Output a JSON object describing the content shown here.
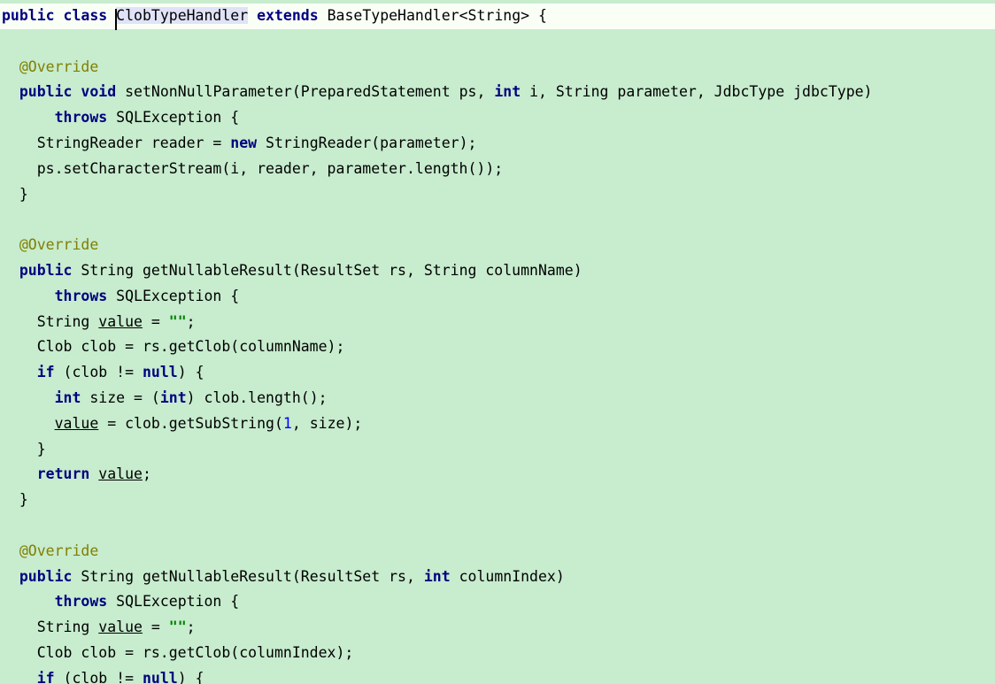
{
  "editor": {
    "language": "java",
    "colors": {
      "background": "#c7ecce",
      "current_line": "#fafff6",
      "keyword": "#000080",
      "annotation": "#808000",
      "string": "#008000",
      "number": "#0000ff",
      "identifier_highlight": "#e0e3f8"
    },
    "lines": [
      {
        "tokens": [
          {
            "t": "public",
            "c": "kw"
          },
          {
            "t": " "
          },
          {
            "t": "class",
            "c": "kw"
          },
          {
            "t": " "
          },
          {
            "t": "ClobTypeHandler",
            "c": "hl",
            "caret": true
          },
          {
            "t": " "
          },
          {
            "t": "extends",
            "c": "kw"
          },
          {
            "t": " BaseTypeHandler<String> {"
          }
        ],
        "current": true
      },
      {
        "tokens": []
      },
      {
        "tokens": [
          {
            "t": "  "
          },
          {
            "t": "@Override",
            "c": "ann"
          }
        ]
      },
      {
        "tokens": [
          {
            "t": "  "
          },
          {
            "t": "public",
            "c": "kw"
          },
          {
            "t": " "
          },
          {
            "t": "void",
            "c": "kw"
          },
          {
            "t": " setNonNullParameter(PreparedStatement ps, "
          },
          {
            "t": "int",
            "c": "kw"
          },
          {
            "t": " i, String parameter, JdbcType jdbcType)"
          }
        ]
      },
      {
        "tokens": [
          {
            "t": "      "
          },
          {
            "t": "throws",
            "c": "kw"
          },
          {
            "t": " SQLException {"
          }
        ]
      },
      {
        "tokens": [
          {
            "t": "    StringReader reader = "
          },
          {
            "t": "new",
            "c": "kw"
          },
          {
            "t": " StringReader(parameter);"
          }
        ]
      },
      {
        "tokens": [
          {
            "t": "    ps.setCharacterStream(i, reader, parameter.length());"
          }
        ]
      },
      {
        "tokens": [
          {
            "t": "  }"
          }
        ]
      },
      {
        "tokens": []
      },
      {
        "tokens": [
          {
            "t": "  "
          },
          {
            "t": "@Override",
            "c": "ann"
          }
        ]
      },
      {
        "tokens": [
          {
            "t": "  "
          },
          {
            "t": "public",
            "c": "kw"
          },
          {
            "t": " String getNullableResult(ResultSet rs, String columnName)"
          }
        ]
      },
      {
        "tokens": [
          {
            "t": "      "
          },
          {
            "t": "throws",
            "c": "kw"
          },
          {
            "t": " SQLException {"
          }
        ]
      },
      {
        "tokens": [
          {
            "t": "    String "
          },
          {
            "t": "value",
            "c": "und"
          },
          {
            "t": " = "
          },
          {
            "t": "\"\"",
            "c": "str"
          },
          {
            "t": ";"
          }
        ]
      },
      {
        "tokens": [
          {
            "t": "    Clob clob = rs.getClob(columnName);"
          }
        ]
      },
      {
        "tokens": [
          {
            "t": "    "
          },
          {
            "t": "if",
            "c": "kw"
          },
          {
            "t": " (clob != "
          },
          {
            "t": "null",
            "c": "kw"
          },
          {
            "t": ") {"
          }
        ]
      },
      {
        "tokens": [
          {
            "t": "      "
          },
          {
            "t": "int",
            "c": "kw"
          },
          {
            "t": " size = ("
          },
          {
            "t": "int",
            "c": "kw"
          },
          {
            "t": ") clob.length();"
          }
        ]
      },
      {
        "tokens": [
          {
            "t": "      "
          },
          {
            "t": "value",
            "c": "und"
          },
          {
            "t": " = clob.getSubString("
          },
          {
            "t": "1",
            "c": "num"
          },
          {
            "t": ", size);"
          }
        ]
      },
      {
        "tokens": [
          {
            "t": "    }"
          }
        ]
      },
      {
        "tokens": [
          {
            "t": "    "
          },
          {
            "t": "return",
            "c": "kw"
          },
          {
            "t": " "
          },
          {
            "t": "value",
            "c": "und"
          },
          {
            "t": ";"
          }
        ]
      },
      {
        "tokens": [
          {
            "t": "  }"
          }
        ]
      },
      {
        "tokens": []
      },
      {
        "tokens": [
          {
            "t": "  "
          },
          {
            "t": "@Override",
            "c": "ann"
          }
        ]
      },
      {
        "tokens": [
          {
            "t": "  "
          },
          {
            "t": "public",
            "c": "kw"
          },
          {
            "t": " String getNullableResult(ResultSet rs, "
          },
          {
            "t": "int",
            "c": "kw"
          },
          {
            "t": " columnIndex)"
          }
        ]
      },
      {
        "tokens": [
          {
            "t": "      "
          },
          {
            "t": "throws",
            "c": "kw"
          },
          {
            "t": " SQLException {"
          }
        ]
      },
      {
        "tokens": [
          {
            "t": "    String "
          },
          {
            "t": "value",
            "c": "und"
          },
          {
            "t": " = "
          },
          {
            "t": "\"\"",
            "c": "str"
          },
          {
            "t": ";"
          }
        ]
      },
      {
        "tokens": [
          {
            "t": "    Clob clob = rs.getClob(columnIndex);"
          }
        ]
      },
      {
        "tokens": [
          {
            "t": "    "
          },
          {
            "t": "if",
            "c": "kw"
          },
          {
            "t": " (clob != "
          },
          {
            "t": "null",
            "c": "kw"
          },
          {
            "t": ") {"
          }
        ]
      }
    ]
  }
}
